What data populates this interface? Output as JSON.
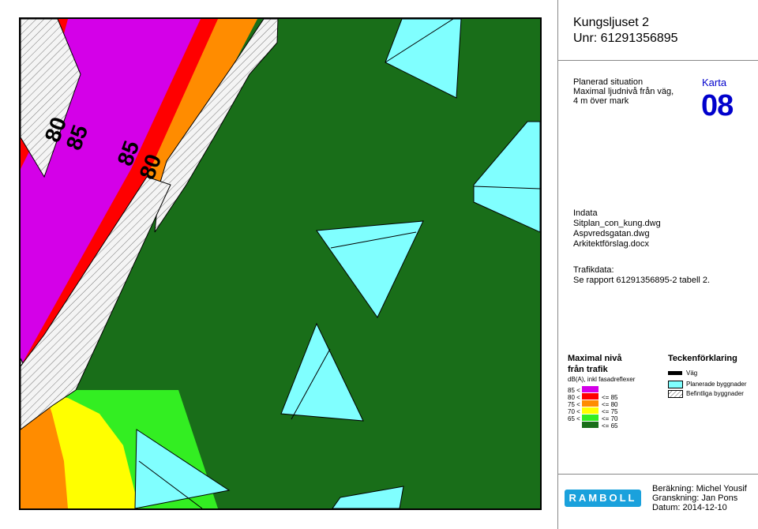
{
  "header": {
    "project_name": "Kungsljuset 2",
    "project_number": "Unr: 61291356895"
  },
  "map_description": {
    "line1": "Planerad situation",
    "line2": "Maximal ljudnivå från väg,",
    "line3": "4 m över mark"
  },
  "map_id": {
    "label": "Karta",
    "number": "08"
  },
  "input_data": {
    "heading": "Indata",
    "files": [
      "Sitplan_con_kung.dwg",
      "Aspvredsgatan.dwg",
      "Arkitektförslag.docx"
    ]
  },
  "traffic_data": {
    "heading": "Trafikdata:",
    "reference": "Se rapport 61291356895-2 tabell 2."
  },
  "map_labels": [
    "80",
    "85",
    "85",
    "80"
  ],
  "noise_legend": {
    "title_line1": "Maximal nivå",
    "title_line2": "från trafik",
    "unit": "dB(A), inkl fasadreflexer",
    "bands": [
      {
        "low": "85 <",
        "high": "",
        "color": "#d400e8"
      },
      {
        "low": "80 <",
        "high": "<= 85",
        "color": "#ff0000"
      },
      {
        "low": "75 <",
        "high": "<= 80",
        "color": "#ff8c00"
      },
      {
        "low": "70 <",
        "high": "<= 75",
        "color": "#ffff00"
      },
      {
        "low": "65 <",
        "high": "<= 70",
        "color": "#33ee22"
      },
      {
        "low": "",
        "high": "<= 65",
        "color": "#196e19"
      }
    ]
  },
  "symbol_legend": {
    "title": "Teckenförklaring",
    "items": [
      {
        "label": "Väg",
        "symbol": "road-line"
      },
      {
        "label": "Planerade byggnader",
        "symbol": "cyan-fill"
      },
      {
        "label": "Befintliga byggnader",
        "symbol": "hatched-fill"
      }
    ]
  },
  "logo": {
    "text": "RAMBOLL"
  },
  "credits": {
    "calculation": "Beräkning: Michel Yousif",
    "review": "Granskning: Jan Pons",
    "date": "Datum: 2014-12-10"
  },
  "colors": {
    "planned_building": "#80ffff",
    "existing_building": "#f0f0f0",
    "accent_blue": "#0000cc",
    "logo_blue": "#1aa1dc"
  }
}
